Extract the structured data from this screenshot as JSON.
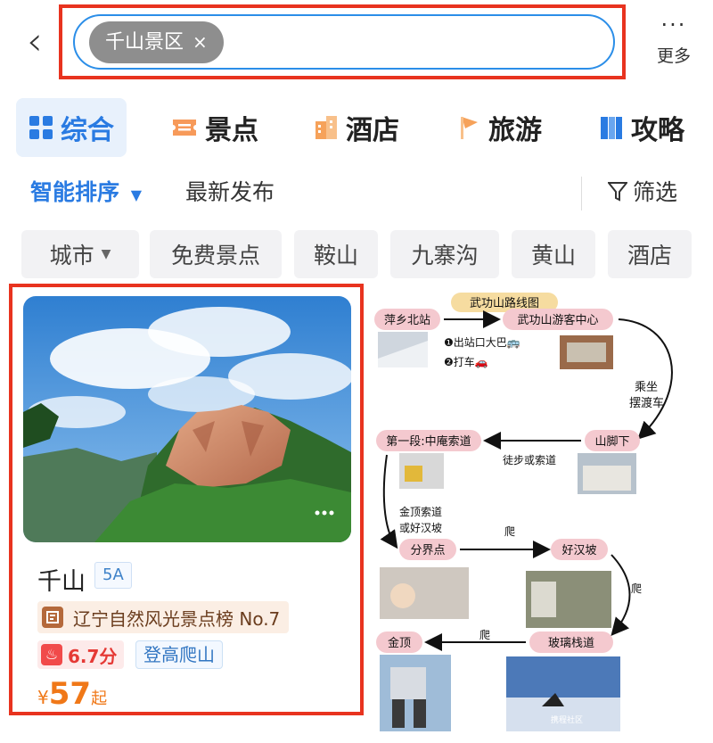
{
  "header": {
    "back_icon": "chevron-left-icon",
    "search_chip": "千山景区",
    "chip_close": "×",
    "more_label": "更多",
    "more_icon": "ellipsis-icon"
  },
  "tabs": [
    {
      "label": "综合",
      "icon": "grid-icon",
      "active": true
    },
    {
      "label": "景点",
      "icon": "ticket-icon",
      "active": false
    },
    {
      "label": "酒店",
      "icon": "building-icon",
      "active": false
    },
    {
      "label": "旅游",
      "icon": "flag-icon",
      "active": false
    },
    {
      "label": "攻略",
      "icon": "book-icon",
      "active": false
    }
  ],
  "sort": {
    "smart": "智能排序",
    "latest": "最新发布",
    "filter": "筛选"
  },
  "filter_chips": [
    "城市",
    "免费景点",
    "鞍山",
    "九寨沟",
    "黄山",
    "酒店"
  ],
  "card": {
    "name": "千山",
    "grade": "5A",
    "rank": "辽宁自然风光景点榜 No.7",
    "score": "6.7分",
    "tag": "登高爬山",
    "currency": "¥",
    "price": "57",
    "price_suffix": "起"
  },
  "route_map": {
    "title": "武功山路线图",
    "station": "萍乡北站",
    "visitor_center": "武功山游客中心",
    "option_bus": "❶出站口大巴🚌",
    "option_taxi": "❷打车🚗",
    "ferry_1": "乘坐",
    "ferry_2": "摆渡车",
    "foot": "山脚下",
    "walk_or_cable": "徒步或索道",
    "segment_one": "第一段:中庵索道",
    "jinding_cable_1": "金顶索道",
    "jinding_cable_2": "或好汉坡",
    "climb_1": "爬",
    "fenjie": "分界点",
    "haohanpo": "好汉坡",
    "climb_2": "爬",
    "glass_path": "玻璃栈道",
    "climb_3": "爬",
    "jinding": "金顶",
    "watermark": "携程社区"
  },
  "colors": {
    "accent_blue": "#2a7be2",
    "highlight_red": "#e8331f",
    "price_orange": "#f07818",
    "map_pill": "#f4c9cf"
  }
}
